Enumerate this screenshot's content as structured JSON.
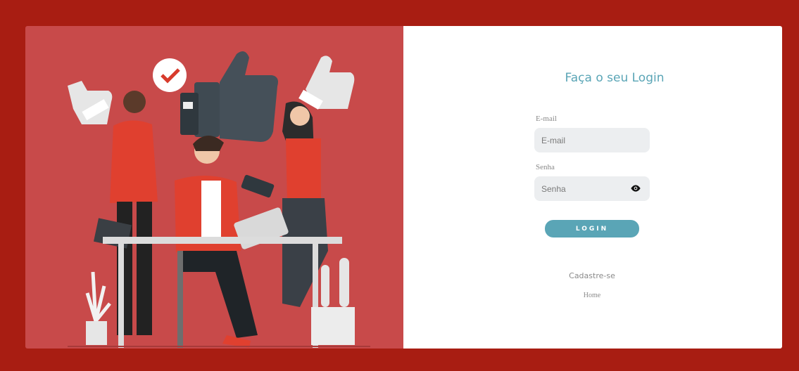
{
  "login": {
    "title": "Faça o seu Login",
    "email_label": "E-mail",
    "email_placeholder": "E-mail",
    "email_value": "",
    "password_label": "Senha",
    "password_placeholder": "Senha",
    "password_value": "",
    "login_button": "LOGIN",
    "register_link": "Cadastre-se",
    "home_link": "Home"
  },
  "theme": {
    "background": "#a81d12",
    "illustration_bg": "#c84a4a",
    "accent": "#5aa5b6",
    "input_bg": "#eceef0"
  },
  "icons": {
    "password_toggle": "eye-icon"
  },
  "illustration": {
    "subject": "teamwork-likes-illustration"
  }
}
